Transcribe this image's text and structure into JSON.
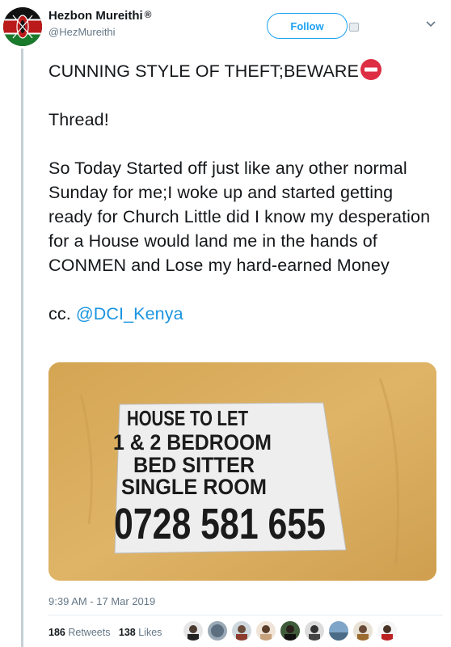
{
  "author": {
    "name": "Hezbon Mureithi",
    "badge": "®",
    "handle": "@HezMureithi"
  },
  "actions": {
    "follow_label": "Follow"
  },
  "tweet": {
    "line1": "CUNNING STYLE OF THEFT;BEWARE",
    "line2": "Thread!",
    "line3": "So Today Started off just like any other normal Sunday for me;I woke up and started getting ready for Church Little did I know my desperation for a House would land me in the hands of CONMEN and Lose my hard-earned Money",
    "cc_prefix": "cc. ",
    "mention": "@DCI_Kenya"
  },
  "sign": {
    "line1": "HOUSE TO LET",
    "line2": "1 & 2 BEDROOM",
    "line3": "BED SITTER",
    "line4": "SINGLE ROOM",
    "phone": "0728 581 655"
  },
  "meta": {
    "timestamp": "9:39 AM - 17 Mar 2019",
    "retweets": "186",
    "retweets_label": "Retweets",
    "likes": "138",
    "likes_label": "Likes"
  },
  "icons": {
    "stop": "no-entry-icon",
    "chevron": "chevron-down-icon"
  },
  "colors": {
    "accent": "#1da1f2",
    "mention": "#1b95e0",
    "wall": "#d9ad5e",
    "stop_red": "#dd2e44"
  }
}
